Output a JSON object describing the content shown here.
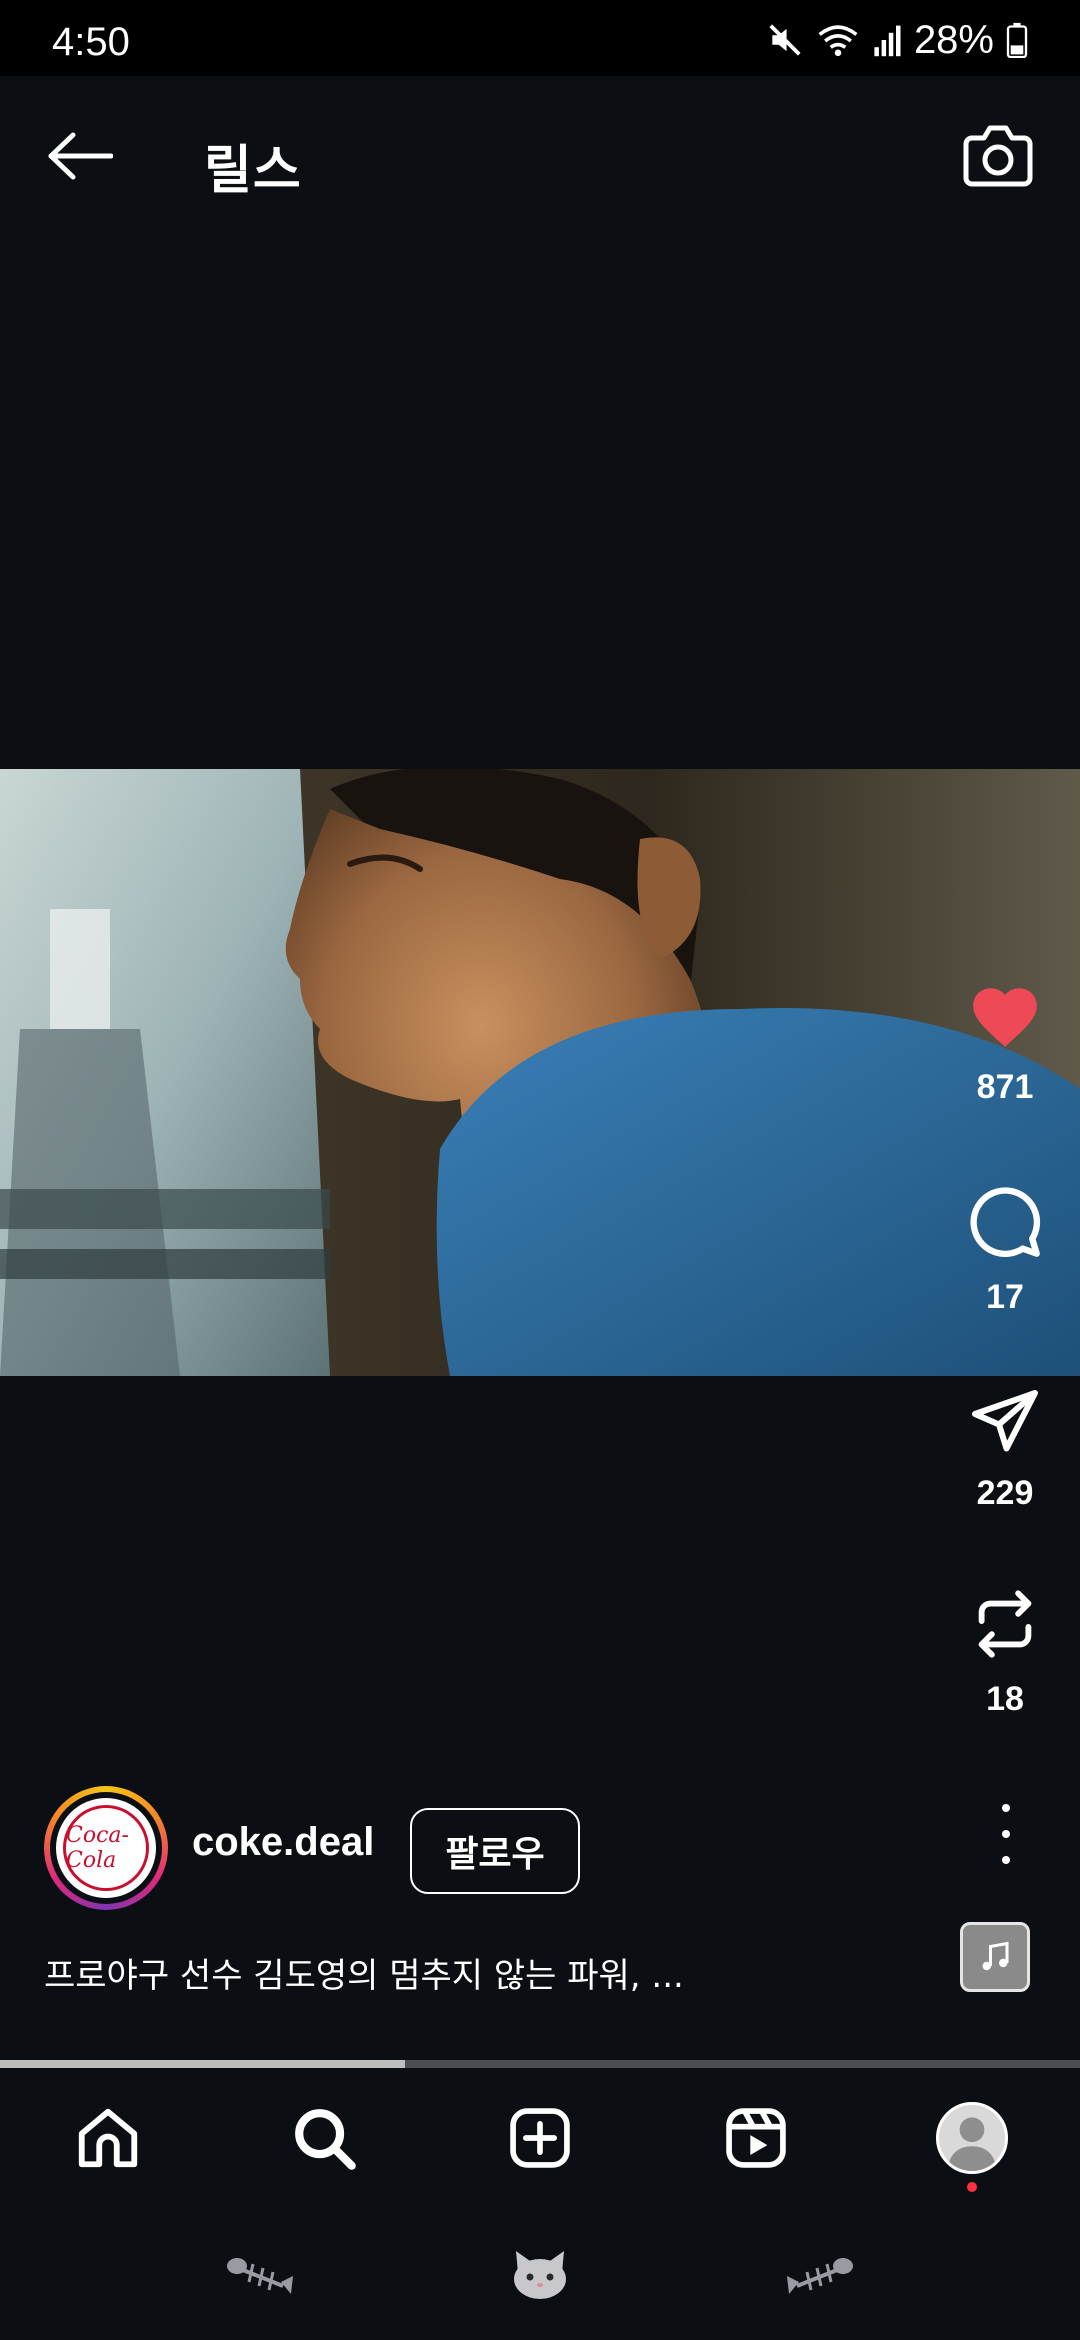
{
  "status_bar": {
    "time": "4:50",
    "battery": "28%"
  },
  "header": {
    "title": "릴스"
  },
  "actions": {
    "likes": "871",
    "comments": "17",
    "shares": "229",
    "remixes": "18"
  },
  "account": {
    "username": "coke.deal",
    "follow_label": "팔로우",
    "avatar_text": "Coca-Cola"
  },
  "caption": "프로야구 선수 김도영의 멈추지 않는 파워, ...",
  "progress": {
    "fraction": 0.375
  },
  "colors": {
    "like": "#ed4956",
    "background": "#0b0e13",
    "notification": "#ff3040"
  }
}
